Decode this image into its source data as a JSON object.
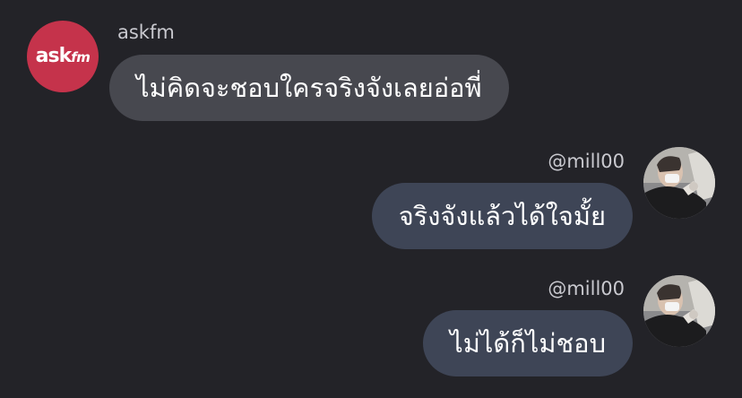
{
  "askfm": {
    "logo_text_ask": "ask",
    "logo_text_fm": "fm",
    "sender_name": "askfm",
    "message": "ไม่คิดจะชอบใครจริงจังเลยอ่อพี่"
  },
  "replies": [
    {
      "sender_name": "@mill00",
      "message": "จริงจังแล้วได้ใจมั้ย"
    },
    {
      "sender_name": "@mill00",
      "message": "ไม่ได้ก็ไม่ชอบ"
    }
  ],
  "colors": {
    "background": "#232328",
    "askfm_brand": "#c5334b",
    "incoming_bubble": "#47484f",
    "outgoing_bubble": "#3e4556"
  },
  "icons": {
    "askfm_avatar": "askfm-logo-icon",
    "user_avatar": "user-photo-avatar"
  }
}
